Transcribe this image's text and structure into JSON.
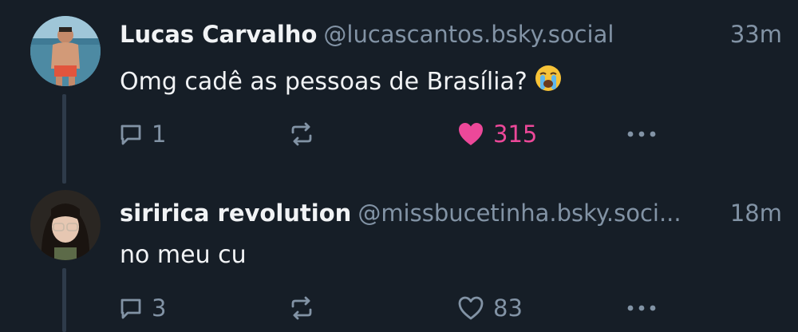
{
  "posts": [
    {
      "author_name": "Lucas Carvalho",
      "handle": "@lucascantos.bsky.social",
      "time": "33m",
      "text": "Omg cadê as pessoas de Brasília?",
      "emoji": "loudly-crying-face-emoji",
      "replies": "1",
      "likes": "315",
      "liked": true
    },
    {
      "author_name": "siririca revolution",
      "handle": "@missbucetinha.bsky.soci...",
      "time": "18m",
      "text": "no meu cu",
      "replies": "3",
      "likes": "83",
      "liked": false
    }
  ],
  "colors": {
    "background": "#161e27",
    "text": "#f1f3f5",
    "muted": "#8293a5",
    "like": "#ec4899",
    "thread_line": "#2e3b4a"
  }
}
